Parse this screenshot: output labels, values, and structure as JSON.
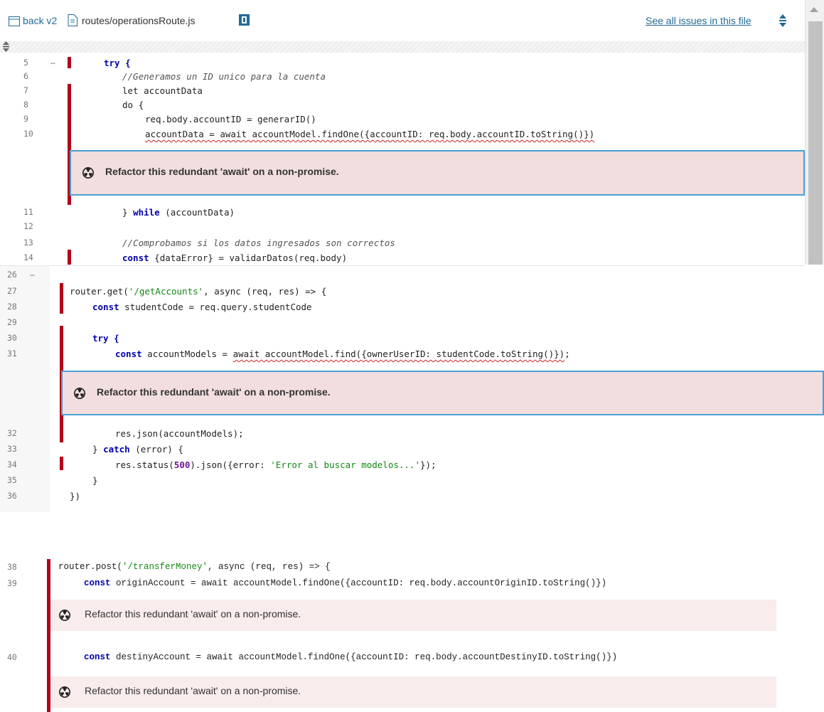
{
  "header": {
    "project": "back v2",
    "file_path": "routes/operationsRoute.js",
    "see_all_link": "See all issues in this file"
  },
  "colors": {
    "issue_bar": "#b3001b",
    "issue_bg": "#f2dede",
    "highlight_border": "#4b9fd5",
    "link": "#236a97"
  },
  "issue_message": "Refactor this redundant 'await' on a non-promise.",
  "ellipsis": "…",
  "section1": {
    "lines": [
      {
        "n": "5",
        "code": "try {"
      },
      {
        "n": "6",
        "code": "//Generamos un ID unico para la cuenta"
      },
      {
        "n": "7",
        "code": "let accountData"
      },
      {
        "n": "8",
        "code": "do {"
      },
      {
        "n": "9",
        "code": "req.body.accountID = generarID()"
      },
      {
        "n": "10",
        "code": "accountData = await accountModel.findOne({accountID: req.body.accountID.toString()})"
      },
      {
        "n": "11",
        "code": "} while (accountData)"
      },
      {
        "n": "12",
        "code": ""
      },
      {
        "n": "13",
        "code": "//Comprobamos si los datos ingresados son correctos"
      },
      {
        "n": "14",
        "code": "const {dataError} = validarDatos(req.body)"
      }
    ]
  },
  "section2": {
    "lines": [
      {
        "n": "26",
        "code": ""
      },
      {
        "n": "27",
        "code": "router.get('/getAccounts', async (req, res) => {"
      },
      {
        "n": "28",
        "code": "const studentCode = req.query.studentCode"
      },
      {
        "n": "29",
        "code": ""
      },
      {
        "n": "30",
        "code": "try {"
      },
      {
        "n": "31",
        "code": "const accountModels = await accountModel.find({ownerUserID: studentCode.toString()});"
      },
      {
        "n": "32",
        "code": "res.json(accountModels);"
      },
      {
        "n": "33",
        "code": "} catch (error) {"
      },
      {
        "n": "34",
        "code": "res.status(500).json({error: 'Error al buscar modelos...'});"
      },
      {
        "n": "35",
        "code": "}"
      },
      {
        "n": "36",
        "code": "})"
      }
    ]
  },
  "section3": {
    "lines": [
      {
        "n": "38",
        "code": "router.post('/transferMoney', async (req, res) => {"
      },
      {
        "n": "39",
        "code": "const originAccount = await accountModel.findOne({accountID: req.body.accountOriginID.toString()})"
      },
      {
        "n": "40",
        "code": "const destinyAccount = await accountModel.findOne({accountID: req.body.accountDestinyID.toString()})"
      }
    ]
  }
}
